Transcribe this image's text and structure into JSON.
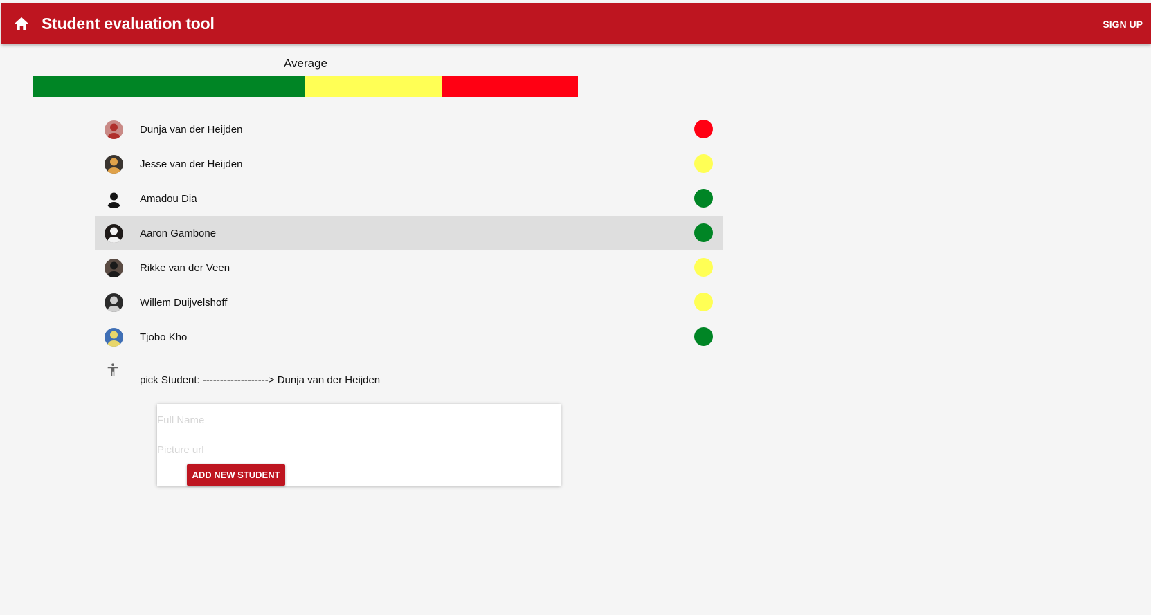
{
  "appbar": {
    "title": "Student evaluation tool",
    "home_icon": "home-icon",
    "signup_label": "SIGN UP",
    "color": "#be1520"
  },
  "average": {
    "label": "Average",
    "segments": [
      {
        "color": "#008525",
        "fraction": 0.5
      },
      {
        "color": "#ffff55",
        "fraction": 0.25
      },
      {
        "color": "#ff0013",
        "fraction": 0.25
      }
    ]
  },
  "students": [
    {
      "name": "Dunja van der Heijden",
      "status": "red",
      "color": "#ff0013",
      "selected": false
    },
    {
      "name": "Jesse van der Heijden",
      "status": "yellow",
      "color": "#ffff55",
      "selected": false
    },
    {
      "name": "Amadou Dia",
      "status": "green",
      "color": "#008525",
      "selected": false
    },
    {
      "name": "Aaron Gambone",
      "status": "green",
      "color": "#008525",
      "selected": true
    },
    {
      "name": "Rikke van der Veen",
      "status": "yellow",
      "color": "#ffff55",
      "selected": false
    },
    {
      "name": "Willem Duijvelshoff",
      "status": "yellow",
      "color": "#ffff55",
      "selected": false
    },
    {
      "name": "Tjobo Kho",
      "status": "green",
      "color": "#008525",
      "selected": false
    }
  ],
  "pick": {
    "icon": "accessibility-icon",
    "text": "pick Student: -------------------> Dunja van der Heijden"
  },
  "form": {
    "full_name_placeholder": "Full Name",
    "full_name_value": "",
    "picture_url_placeholder": "Picture url",
    "picture_url_value": "",
    "add_button_label": "ADD NEW STUDENT"
  }
}
